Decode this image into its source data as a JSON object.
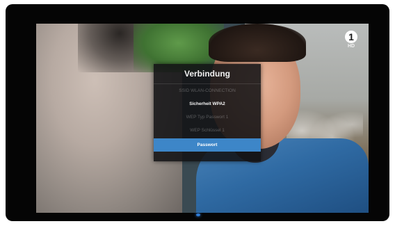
{
  "channel": {
    "logo_text": "1",
    "hd_label": "HD"
  },
  "menu": {
    "title": "Verbindung",
    "items": [
      {
        "label": "SSID WLAN-CONNECTION",
        "state": "dimmed"
      },
      {
        "label": "Sicherheit WPA2",
        "state": "active"
      },
      {
        "label": "WEP Typ Passwort 1",
        "state": "dimmed"
      },
      {
        "label": "WEP Schlüssel 1",
        "state": "dimmed"
      },
      {
        "label": "Passwort",
        "state": "selected"
      }
    ]
  },
  "colors": {
    "selection": "#3d86c8",
    "menu_bg": "#121214",
    "led": "#2f7cd6"
  },
  "icons": {
    "led": "power-led-icon",
    "logo": "channel-logo-icon"
  }
}
